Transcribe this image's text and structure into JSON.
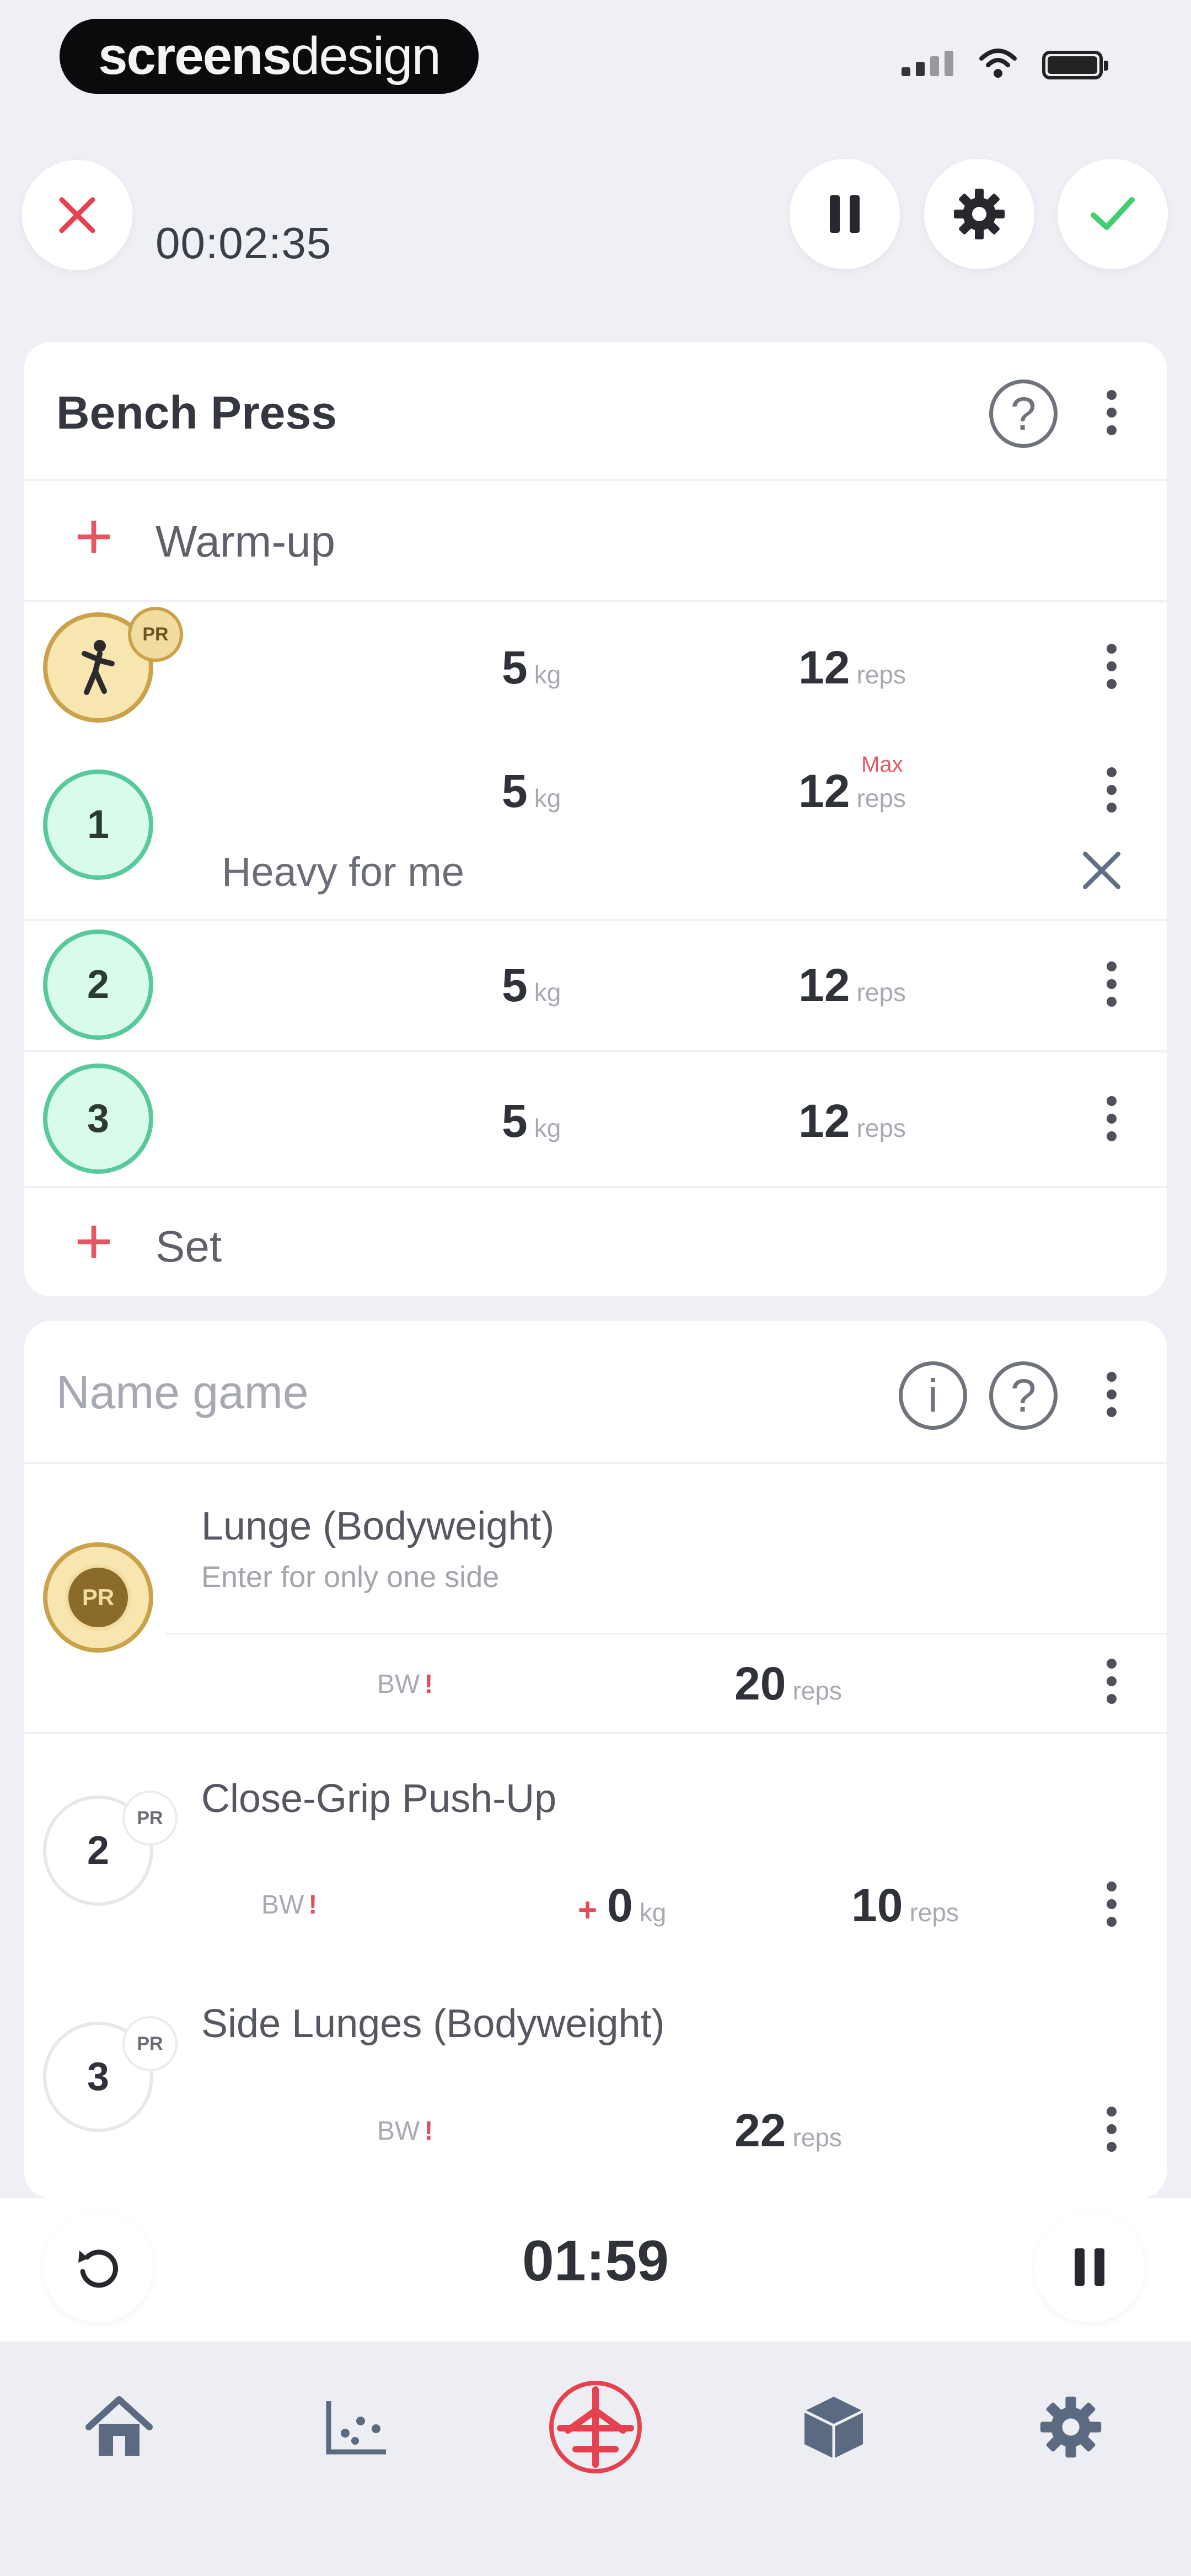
{
  "status_bar": {
    "brand_left": "screens",
    "brand_right": "design"
  },
  "top_bar": {
    "elapsed": "00:02:35"
  },
  "exercise1": {
    "title": "Bench Press",
    "warmup_label": "Warm-up",
    "add_set_label": "Set",
    "sets": [
      {
        "marker": "",
        "pr": "PR",
        "weight": "5",
        "weight_unit": "kg",
        "reps": "12",
        "reps_unit": "reps"
      },
      {
        "marker": "1",
        "weight": "5",
        "weight_unit": "kg",
        "reps": "12",
        "reps_unit": "reps",
        "max_label": "Max",
        "note": "Heavy for me"
      },
      {
        "marker": "2",
        "weight": "5",
        "weight_unit": "kg",
        "reps": "12",
        "reps_unit": "reps"
      },
      {
        "marker": "3",
        "weight": "5",
        "weight_unit": "kg",
        "reps": "12",
        "reps_unit": "reps"
      }
    ]
  },
  "exercise2": {
    "title": "Name game",
    "items": [
      {
        "marker": "PR",
        "name": "Lunge (Bodyweight)",
        "subtitle": "Enter for only one side",
        "bw": "BW",
        "bw_mark": "!",
        "reps": "20",
        "reps_unit": "reps"
      },
      {
        "marker": "2",
        "pr": "PR",
        "name": "Close-Grip Push-Up",
        "bw": "BW",
        "bw_mark": "!",
        "plus": "+",
        "weight": "0",
        "weight_unit": "kg",
        "reps": "10",
        "reps_unit": "reps"
      },
      {
        "marker": "3",
        "pr": "PR",
        "name": "Side Lunges (Bodyweight)",
        "bw": "BW",
        "bw_mark": "!",
        "reps": "22",
        "reps_unit": "reps"
      }
    ]
  },
  "rest_timer": {
    "value": "01:59"
  },
  "icons": {
    "close": "close-icon",
    "pause": "pause-icon",
    "settings": "gear-icon",
    "confirm": "check-icon",
    "help": "help-icon",
    "info": "info-icon",
    "more": "kebab-icon",
    "add": "plus-icon",
    "restart": "restart-icon",
    "home": "home-icon",
    "stats": "chart-icon",
    "workout": "plane-icon",
    "exercises": "cube-icon",
    "nav_settings": "gear-icon"
  },
  "colors": {
    "accent_red": "#e5414f",
    "confirm_green": "#3fcf6e",
    "set_green": "#58c99b",
    "pr_gold": "#c9a24a",
    "nav_icon": "#5b6a80"
  }
}
